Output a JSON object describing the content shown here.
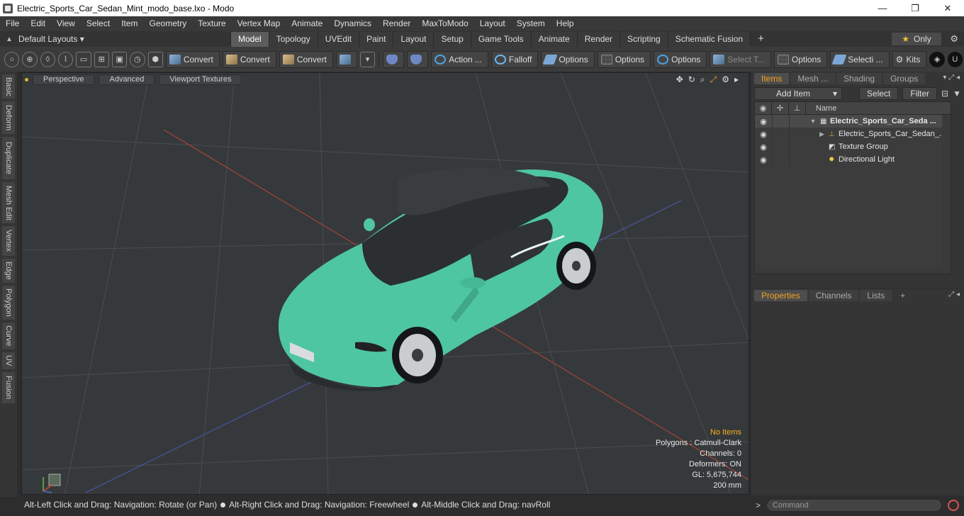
{
  "window": {
    "title": "Electric_Sports_Car_Sedan_Mint_modo_base.lxo - Modo",
    "minimize": "—",
    "maximize": "❐",
    "close": "✕"
  },
  "menu": [
    "File",
    "Edit",
    "View",
    "Select",
    "Item",
    "Geometry",
    "Texture",
    "Vertex Map",
    "Animate",
    "Dynamics",
    "Render",
    "MaxToModo",
    "Layout",
    "System",
    "Help"
  ],
  "layoutbar": {
    "default_layouts": "Default Layouts ▾",
    "tabs": [
      "Model",
      "Topology",
      "UVEdit",
      "Paint",
      "Layout",
      "Setup",
      "Game Tools",
      "Animate",
      "Render",
      "Scripting",
      "Schematic Fusion"
    ],
    "active_tab": "Model",
    "plus": "+",
    "only_label": "Only",
    "star": "★"
  },
  "toolbar": {
    "convert_1": "Convert",
    "convert_2": "Convert",
    "convert_3": "Convert",
    "action": "Action ...",
    "falloff": "Falloff",
    "options_1": "Options",
    "options_2": "Options",
    "options_3": "Options",
    "select_t": "Select T...",
    "options_4": "Options",
    "selecti": "Selecti ...",
    "kits": "Kits"
  },
  "lefttabs": [
    "Basic",
    "Deform",
    "Duplicate",
    "Mesh Edit",
    "Vertex",
    "Edge",
    "Polygon",
    "Curve",
    "UV",
    "Fusion"
  ],
  "viewport": {
    "perspective": "Perspective",
    "advanced": "Advanced",
    "textures": "Viewport Textures",
    "info": {
      "no_items": "No Items",
      "polygons": "Polygons : Catmull-Clark",
      "channels": "Channels: 0",
      "deformers": "Deformers: ON",
      "gl": "GL: 5,675,744",
      "scale": "200 mm"
    }
  },
  "statusbar": {
    "hint1": "Alt-Left Click and Drag: Navigation: Rotate (or Pan)",
    "hint2": "Alt-Right Click and Drag: Navigation: Freewheel",
    "hint3": "Alt-Middle Click and Drag: navRoll"
  },
  "items_panel": {
    "tabs": [
      "Items",
      "Mesh ...",
      "Shading",
      "Groups"
    ],
    "add_item": "Add Item",
    "select": "Select",
    "filter": "Filter",
    "name_col": "Name",
    "rows": [
      "Electric_Sports_Car_Seda ...",
      "Electric_Sports_Car_Sedan_...",
      "Texture Group",
      "Directional Light"
    ]
  },
  "properties_panel": {
    "tabs": [
      "Properties",
      "Channels",
      "Lists"
    ],
    "plus": "+"
  },
  "command": {
    "placeholder": "Command"
  },
  "colors": {
    "car_body": "#4fc6a2",
    "accent": "#f0a020"
  }
}
